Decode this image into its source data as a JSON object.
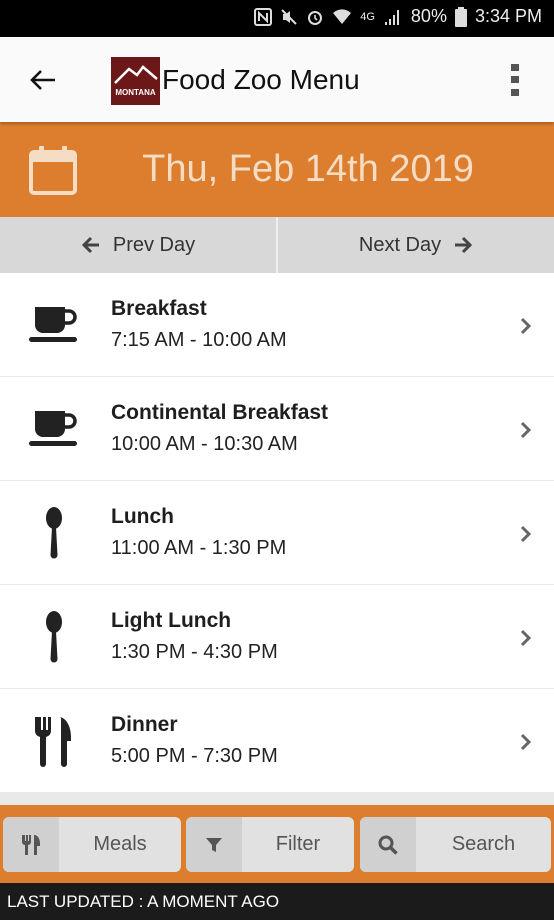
{
  "status_bar": {
    "battery": "80%",
    "time": "3:34 PM",
    "network": "4G"
  },
  "header": {
    "title": "Food Zoo Menu",
    "logo_text": "MONTANA",
    "back_icon": "arrow-left-icon",
    "menu_icon": "more-vertical-icon"
  },
  "date_bar": {
    "date": "Thu, Feb 14th 2019",
    "icon": "calendar-icon"
  },
  "day_nav": {
    "prev_label": "Prev Day",
    "next_label": "Next Day"
  },
  "meals": [
    {
      "name": "Breakfast",
      "time": "7:15 AM - 10:00 AM",
      "icon": "coffee-cup-icon"
    },
    {
      "name": "Continental Breakfast",
      "time": "10:00 AM - 10:30 AM",
      "icon": "coffee-cup-icon"
    },
    {
      "name": "Lunch",
      "time": "11:00 AM - 1:30 PM",
      "icon": "spoon-icon"
    },
    {
      "name": "Light Lunch",
      "time": "1:30 PM - 4:30 PM",
      "icon": "spoon-icon"
    },
    {
      "name": "Dinner",
      "time": "5:00 PM - 7:30 PM",
      "icon": "fork-knife-icon"
    }
  ],
  "toolbar": {
    "meals_label": "Meals",
    "filter_label": "Filter",
    "search_label": "Search"
  },
  "footer": {
    "text": "LAST UPDATED : A MOMENT AGO"
  },
  "colors": {
    "accent": "#dc7e2e",
    "logo": "#6d1818"
  }
}
